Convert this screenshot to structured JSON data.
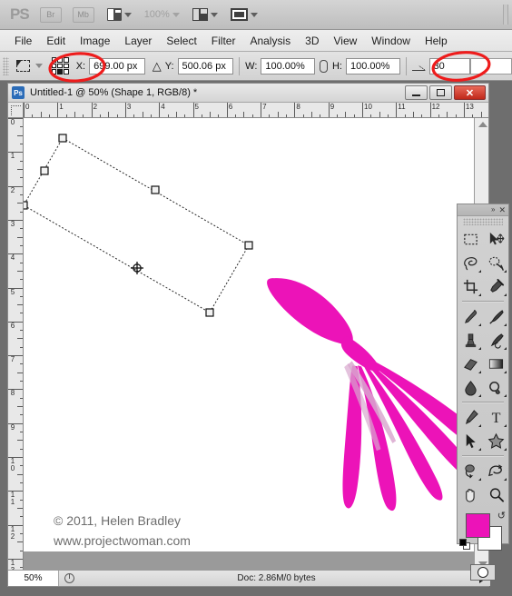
{
  "app": {
    "name": "Adobe Photoshop",
    "logo_text": "PS",
    "bridge_label": "Br",
    "minibridge_label": "Mb",
    "zoom_level": "100%",
    "buttons": [
      {
        "name": "view-extras-dropdown",
        "icon": "view-extras-icon"
      },
      {
        "name": "zoom-level-dropdown",
        "label": "100%"
      },
      {
        "name": "arrange-documents-dropdown",
        "icon": "arrange-documents-icon"
      },
      {
        "name": "screen-mode-dropdown",
        "icon": "screen-mode-icon"
      }
    ]
  },
  "menubar": {
    "items": [
      {
        "label": "File"
      },
      {
        "label": "Edit"
      },
      {
        "label": "Image"
      },
      {
        "label": "Layer"
      },
      {
        "label": "Select"
      },
      {
        "label": "Filter"
      },
      {
        "label": "Analysis"
      },
      {
        "label": "3D"
      },
      {
        "label": "View"
      },
      {
        "label": "Window"
      },
      {
        "label": "Help"
      }
    ]
  },
  "options_bar": {
    "tool_icon_name": "move-tool-preset-icon",
    "reference_point_label": "reference-point-locator",
    "x_label": "X:",
    "x_value": "699.00 px",
    "y_label": "Y:",
    "y_value": "500.06 px",
    "w_label": "W:",
    "w_value": "100.00%",
    "h_label": "H:",
    "h_value": "100.00%",
    "link_icon": "maintain-aspect-ratio-icon",
    "angle_icon": "rotate-angle-icon",
    "angle_value": "30",
    "delta_symbol": "△"
  },
  "document": {
    "title": "Untitled-1 @ 50% (Shape 1, RGB/8) *",
    "tab_icon": "Ps",
    "window_buttons": [
      {
        "name": "minimize-button",
        "label": ""
      },
      {
        "name": "maximize-button",
        "label": ""
      },
      {
        "name": "close-button",
        "label": "✕"
      }
    ],
    "ruler_h_ticks": [
      "0",
      "1",
      "2",
      "3",
      "4",
      "5",
      "6",
      "7",
      "8",
      "9",
      "10",
      "11",
      "12",
      "13"
    ],
    "ruler_v_ticks": [
      "0",
      "1",
      "2",
      "3",
      "4",
      "5",
      "6",
      "7",
      "8",
      "9",
      "10",
      "11",
      "12",
      "13"
    ],
    "watermark_line1": "© 2011, Helen Bradley",
    "watermark_line2": "www.projectwoman.com",
    "canvas_bg": "#ffffff"
  },
  "status_bar": {
    "zoom": "50%",
    "doc_info": "Doc: 2.86M/0 bytes",
    "pie_icon": "proxy-preview-icon",
    "expand_icon": "status-expand-arrow"
  },
  "tools_panel": {
    "collapse_icon": "»",
    "close_icon": "✕",
    "tools": [
      {
        "name": "rectangular-marquee-tool",
        "has_corner": false
      },
      {
        "name": "move-tool",
        "has_corner": false
      },
      {
        "name": "lasso-tool",
        "has_corner": true
      },
      {
        "name": "quick-selection-tool",
        "has_corner": true
      },
      {
        "name": "crop-tool",
        "has_corner": true
      },
      {
        "name": "eyedropper-tool",
        "has_corner": true
      },
      {
        "name": "healing-brush-tool",
        "has_corner": true
      },
      {
        "name": "brush-tool",
        "has_corner": true
      },
      {
        "name": "clone-stamp-tool",
        "has_corner": true
      },
      {
        "name": "history-brush-tool",
        "has_corner": true
      },
      {
        "name": "eraser-tool",
        "has_corner": true
      },
      {
        "name": "gradient-tool",
        "has_corner": true
      },
      {
        "name": "blur-tool",
        "has_corner": true
      },
      {
        "name": "dodge-tool",
        "has_corner": true
      },
      {
        "name": "pen-tool",
        "has_corner": true
      },
      {
        "name": "horizontal-type-tool",
        "has_corner": true
      },
      {
        "name": "path-selection-tool",
        "has_corner": true
      },
      {
        "name": "custom-shape-tool",
        "has_corner": true
      },
      {
        "name": "3d-object-rotate-tool",
        "has_corner": true
      },
      {
        "name": "3d-camera-orbit-tool",
        "has_corner": true
      },
      {
        "name": "hand-tool",
        "has_corner": false
      },
      {
        "name": "zoom-tool",
        "has_corner": false
      }
    ],
    "foreground_color": "#ec13b8",
    "background_color": "#ffffff",
    "quick_mask_label": "edit-in-quick-mask-mode"
  },
  "shape": {
    "fill_color": "#ec13b8",
    "name": "custom-shape-feather",
    "transform_angle_deg": 30
  },
  "annotations": {
    "circle_color": "#ee1c1c",
    "marks": [
      {
        "name": "annotation-circle-reference-point"
      },
      {
        "name": "annotation-circle-rotation-angle"
      }
    ]
  }
}
